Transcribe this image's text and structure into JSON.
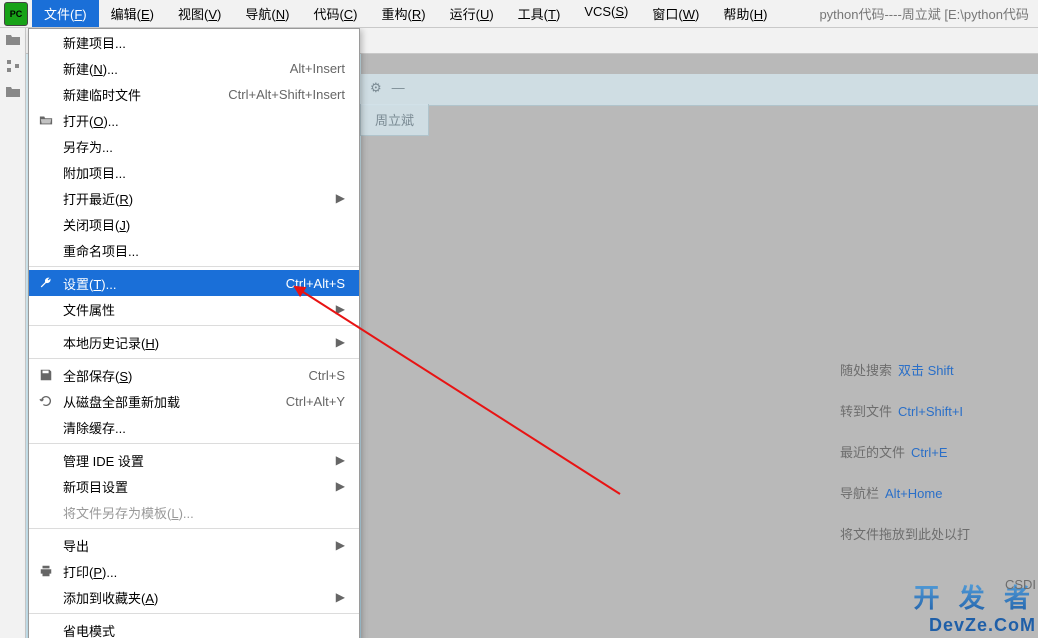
{
  "title": "python代码----周立斌 [E:\\python代码",
  "menubar": [
    "文件(<u>F</u>)",
    "编辑(<u>E</u>)",
    "视图(<u>V</u>)",
    "导航(<u>N</u>)",
    "代码(<u>C</u>)",
    "重构(<u>R</u>)",
    "运行(<u>U</u>)",
    "工具(<u>T</u>)",
    "VCS(<u>S</u>)",
    "窗口(<u>W</u>)",
    "帮助(<u>H</u>)"
  ],
  "menubar_plain": [
    "文件(F)",
    "编辑(E)",
    "视图(V)",
    "导航(N)",
    "代码(C)",
    "重构(R)",
    "运行(U)",
    "工具(T)",
    "VCS(S)",
    "窗口(W)",
    "帮助(H)"
  ],
  "active_menu_index": 0,
  "tab": {
    "label": "周立斌"
  },
  "dropdown": [
    {
      "type": "item",
      "label": "新建项目..."
    },
    {
      "type": "item",
      "label": "新建(N)...",
      "shortcut": "Alt+Insert"
    },
    {
      "type": "item",
      "label": "新建临时文件",
      "shortcut": "Ctrl+Alt+Shift+Insert"
    },
    {
      "type": "item",
      "label": "打开(O)...",
      "icon": "folder-open-icon"
    },
    {
      "type": "item",
      "label": "另存为..."
    },
    {
      "type": "item",
      "label": "附加项目..."
    },
    {
      "type": "item",
      "label": "打开最近(R)",
      "submenu": true
    },
    {
      "type": "item",
      "label": "关闭项目(J)"
    },
    {
      "type": "item",
      "label": "重命名项目..."
    },
    {
      "type": "sep"
    },
    {
      "type": "item",
      "label": "设置(T)...",
      "shortcut": "Ctrl+Alt+S",
      "icon": "wrench-icon",
      "highlight": true
    },
    {
      "type": "item",
      "label": "文件属性",
      "submenu": true
    },
    {
      "type": "sep"
    },
    {
      "type": "item",
      "label": "本地历史记录(H)",
      "submenu": true
    },
    {
      "type": "sep"
    },
    {
      "type": "item",
      "label": "全部保存(S)",
      "shortcut": "Ctrl+S",
      "icon": "save-icon"
    },
    {
      "type": "item",
      "label": "从磁盘全部重新加载",
      "shortcut": "Ctrl+Alt+Y",
      "icon": "reload-icon"
    },
    {
      "type": "item",
      "label": "清除缓存..."
    },
    {
      "type": "sep"
    },
    {
      "type": "item",
      "label": "管理 IDE 设置",
      "submenu": true
    },
    {
      "type": "item",
      "label": "新项目设置",
      "submenu": true
    },
    {
      "type": "item",
      "label": "将文件另存为模板(L)...",
      "disabled": true
    },
    {
      "type": "sep"
    },
    {
      "type": "item",
      "label": "导出",
      "submenu": true
    },
    {
      "type": "item",
      "label": "打印(P)...",
      "icon": "print-icon"
    },
    {
      "type": "item",
      "label": "添加到收藏夹(A)",
      "submenu": true
    },
    {
      "type": "sep"
    },
    {
      "type": "item",
      "label": "省电模式"
    }
  ],
  "shortcuts": [
    {
      "label": "随处搜索",
      "kb": "双击 Shift"
    },
    {
      "label": "转到文件",
      "kb": "Ctrl+Shift+I"
    },
    {
      "label": "最近的文件",
      "kb": "Ctrl+E"
    },
    {
      "label": "导航栏",
      "kb": "Alt+Home"
    },
    {
      "label": "将文件拖放到此处以打",
      "kb": ""
    }
  ],
  "watermark": {
    "line1": "开 发 者",
    "line2": "DevZe.CoM",
    "hint": "CSDI"
  }
}
